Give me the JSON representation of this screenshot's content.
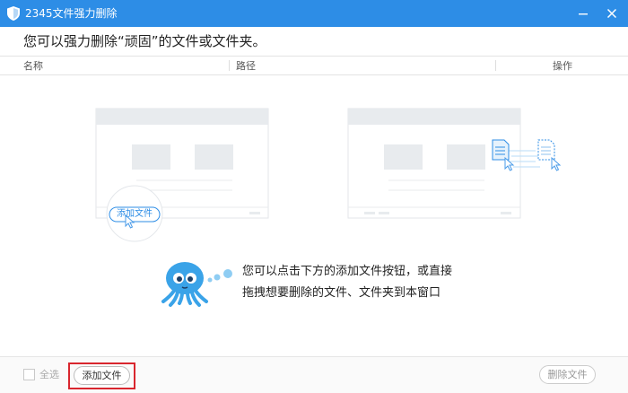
{
  "window": {
    "title": "2345文件强力删除"
  },
  "header": {
    "text": "您可以强力删除“顽固”的文件或文件夹。"
  },
  "columns": {
    "name": "名称",
    "path": "路径",
    "action": "操作"
  },
  "illustration": {
    "add_button_label": "添加文件"
  },
  "hint": {
    "line1": "您可以点击下方的添加文件按钮，或直接",
    "line2": "拖拽想要删除的文件、文件夹到本窗口"
  },
  "footer": {
    "select_all": "全选",
    "add_file": "添加文件",
    "delete_file": "删除文件"
  },
  "colors": {
    "titlebar": "#2d8de6",
    "accent": "#2d8de6",
    "highlight": "#d9262e"
  },
  "icons": [
    "shield-icon",
    "minimize-icon",
    "close-icon",
    "octopus-mascot-icon",
    "document-icon",
    "cursor-icon"
  ]
}
